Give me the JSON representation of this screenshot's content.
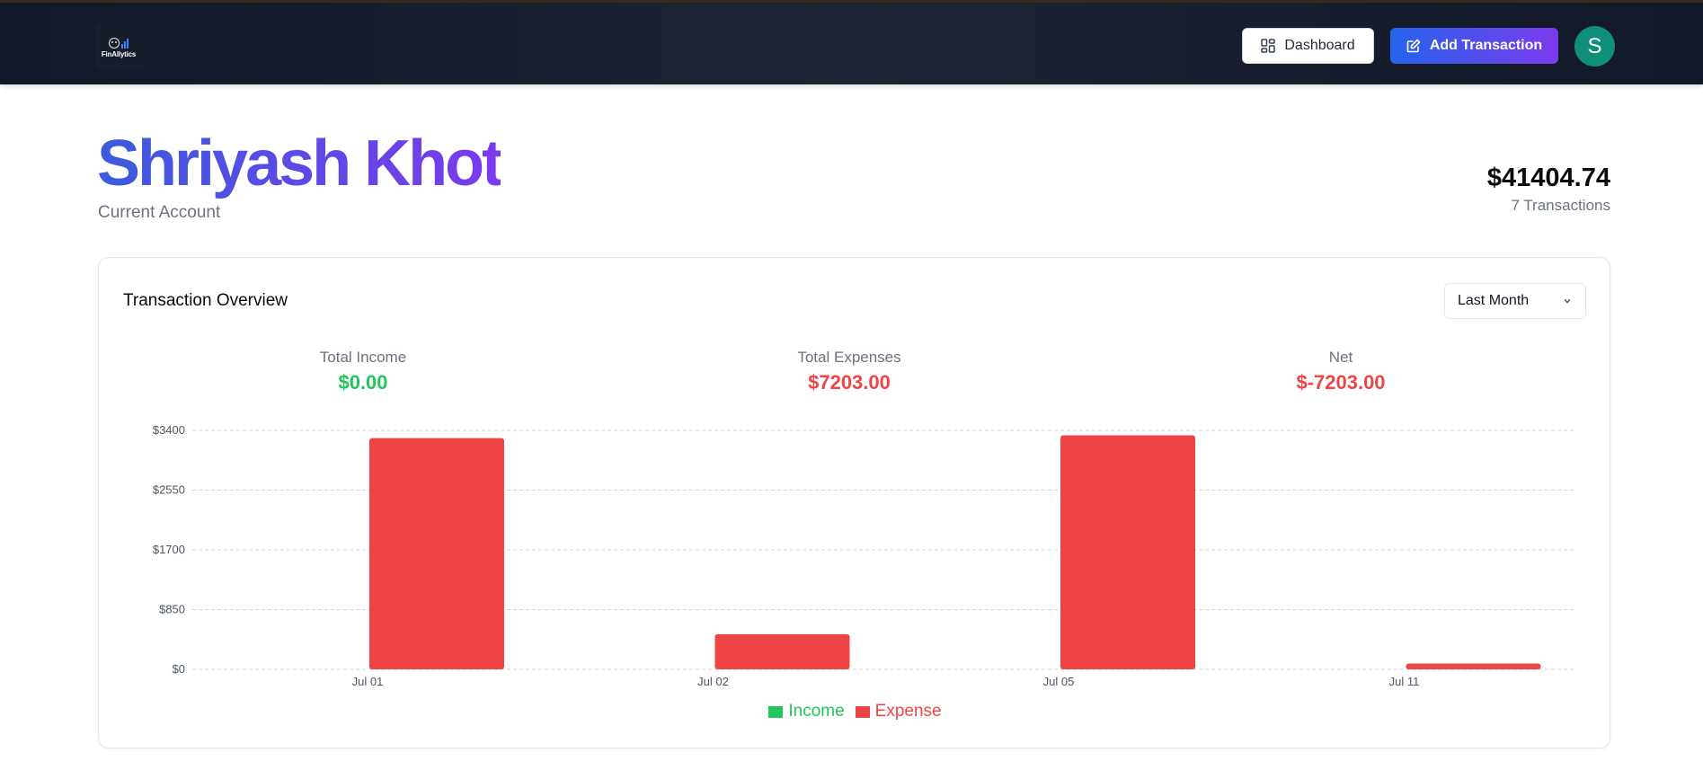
{
  "header": {
    "logo_text": "FinAllytics",
    "dashboard_label": "Dashboard",
    "add_transaction_label": "Add Transaction",
    "avatar_initial": "S"
  },
  "account": {
    "name": "Shriyash Khot",
    "type": "Current Account",
    "balance": "$41404.74",
    "transactions": "7 Transactions"
  },
  "overview": {
    "title": "Transaction Overview",
    "range_selected": "Last Month",
    "stats": [
      {
        "label": "Total Income",
        "value": "$0.00",
        "color": "#22c55e"
      },
      {
        "label": "Total Expenses",
        "value": "$7203.00",
        "color": "#ef4444"
      },
      {
        "label": "Net",
        "value": "$-7203.00",
        "color": "#ef4444"
      }
    ]
  },
  "chart_data": {
    "type": "bar",
    "categories": [
      "Jul 01",
      "Jul 02",
      "Jul 05",
      "Jul 11"
    ],
    "series": [
      {
        "name": "Income",
        "values": [
          0,
          0,
          0,
          0
        ],
        "color": "#22c55e"
      },
      {
        "name": "Expense",
        "values": [
          3290,
          500,
          3330,
          83
        ],
        "color": "#ef4444"
      }
    ],
    "yticks": [
      "$0",
      "$850",
      "$1700",
      "$2550",
      "$3400"
    ],
    "ytick_values": [
      0,
      850,
      1700,
      2550,
      3400
    ],
    "ylim": [
      0,
      3400
    ],
    "grid": true,
    "legend": "bottom-center"
  }
}
